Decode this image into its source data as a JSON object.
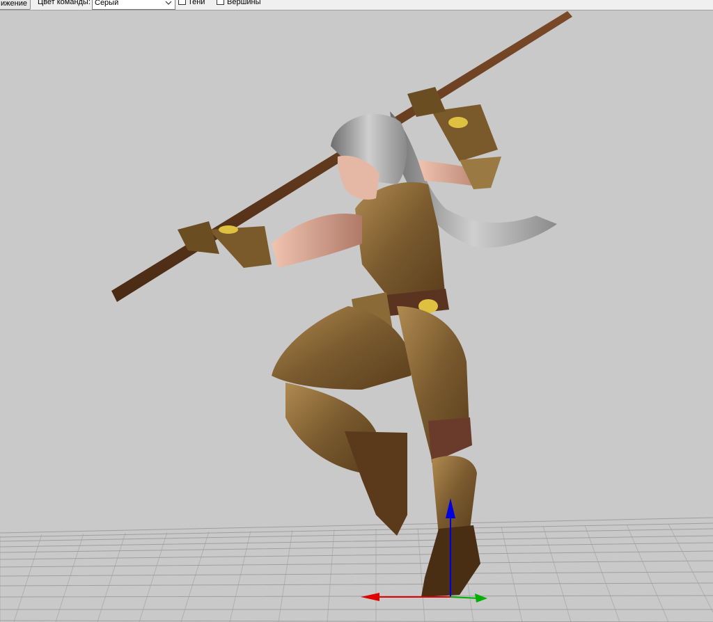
{
  "toolbar": {
    "movement_button_label": "ижение",
    "team_color_label": "Цвет команды:",
    "team_color_value": "Серый",
    "shadows_label": "Тени",
    "shadows_checked": false,
    "vertices_label": "Вершины",
    "vertices_checked": false
  },
  "viewport": {
    "background_color": "#c9c9c9",
    "grid_color": "#9a9a9a",
    "axis_colors": {
      "x": "#e00000",
      "y": "#00b000",
      "z": "#0000e0"
    }
  },
  "icons": {
    "dropdown": "chevron-down-icon",
    "checkbox": "checkbox-icon"
  }
}
